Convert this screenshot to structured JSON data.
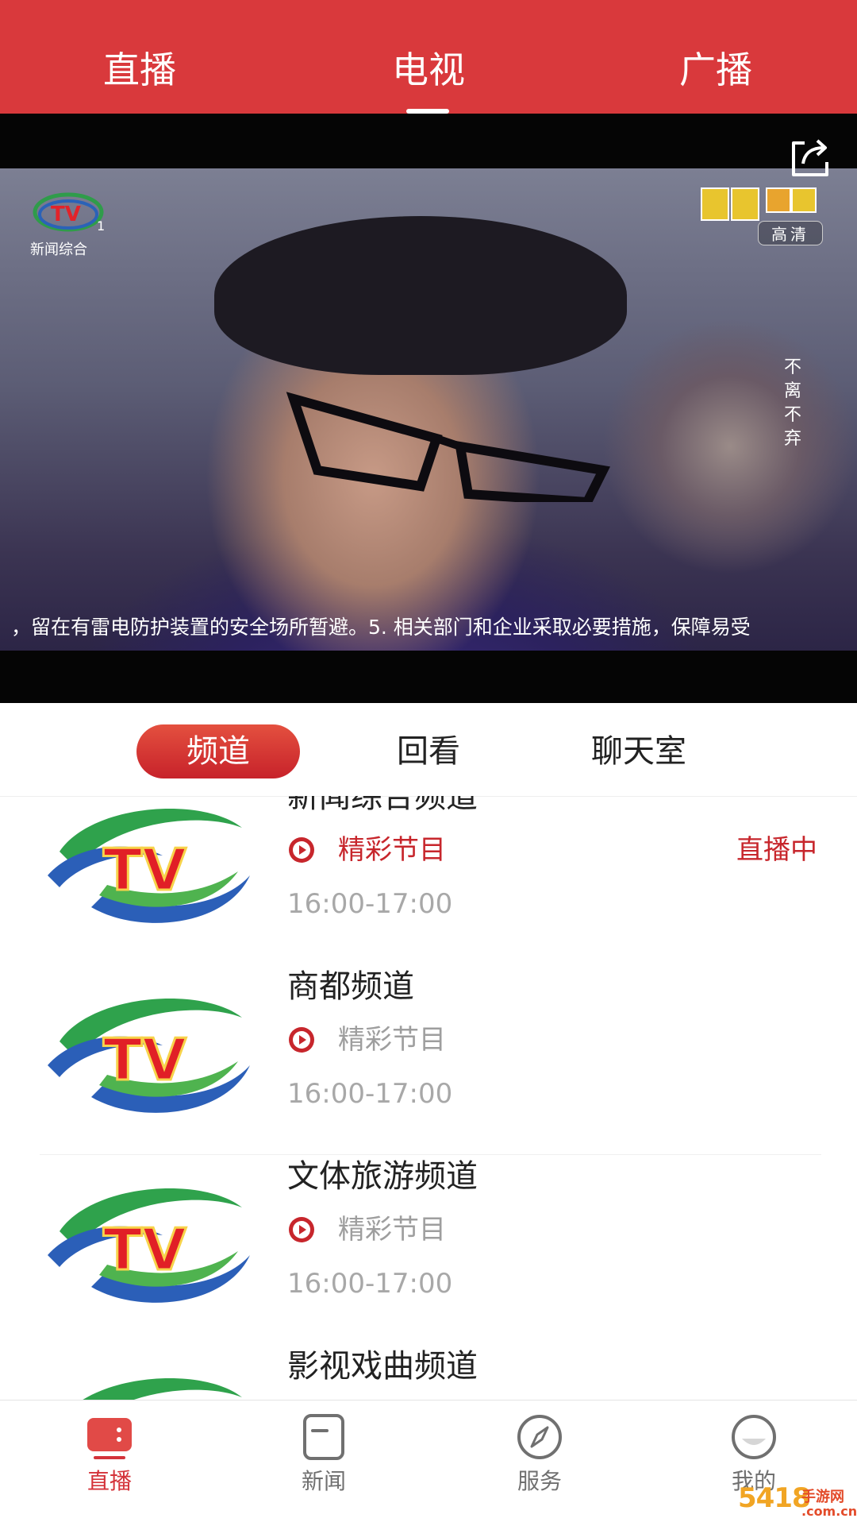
{
  "top_tabs": [
    {
      "label": "直播"
    },
    {
      "label": "电视",
      "active": true
    },
    {
      "label": "广播"
    }
  ],
  "player": {
    "channel_logo_text": "新闻综合",
    "channel_logo_number": "1",
    "quality_label": "高清",
    "vertical_title": "不离不弃",
    "ticker_text": "，留在有雷电防护装置的安全场所暂避。5. 相关部门和企业采取必要措施，保障易受",
    "share_icon": "share-icon"
  },
  "sub_tabs": [
    {
      "label": "频道",
      "active": true
    },
    {
      "label": "回看"
    },
    {
      "label": "聊天室"
    }
  ],
  "channels": [
    {
      "name": "新闻综合频道",
      "program": "精彩节目",
      "time": "16:00-17:00",
      "status": "直播中",
      "live": true
    },
    {
      "name": "商都频道",
      "program": "精彩节目",
      "time": "16:00-17:00",
      "live": false
    },
    {
      "name": "文体旅游频道",
      "program": "精彩节目",
      "time": "16:00-17:00",
      "live": false
    },
    {
      "name": "影视戏曲频道",
      "program": "",
      "time": "",
      "live": false
    }
  ],
  "bottom_nav": [
    {
      "label": "直播",
      "icon": "tv-live-icon",
      "active": true
    },
    {
      "label": "新闻",
      "icon": "news-doc-icon"
    },
    {
      "label": "服务",
      "icon": "compass-icon"
    },
    {
      "label": "我的",
      "icon": "profile-icon"
    }
  ],
  "watermark": {
    "main": "5418",
    "sub": "手游网",
    "domain": ".com.cn"
  },
  "colors": {
    "brand_red": "#d9393c",
    "live_red": "#c7262c",
    "muted_gray": "#9e9e9e"
  }
}
